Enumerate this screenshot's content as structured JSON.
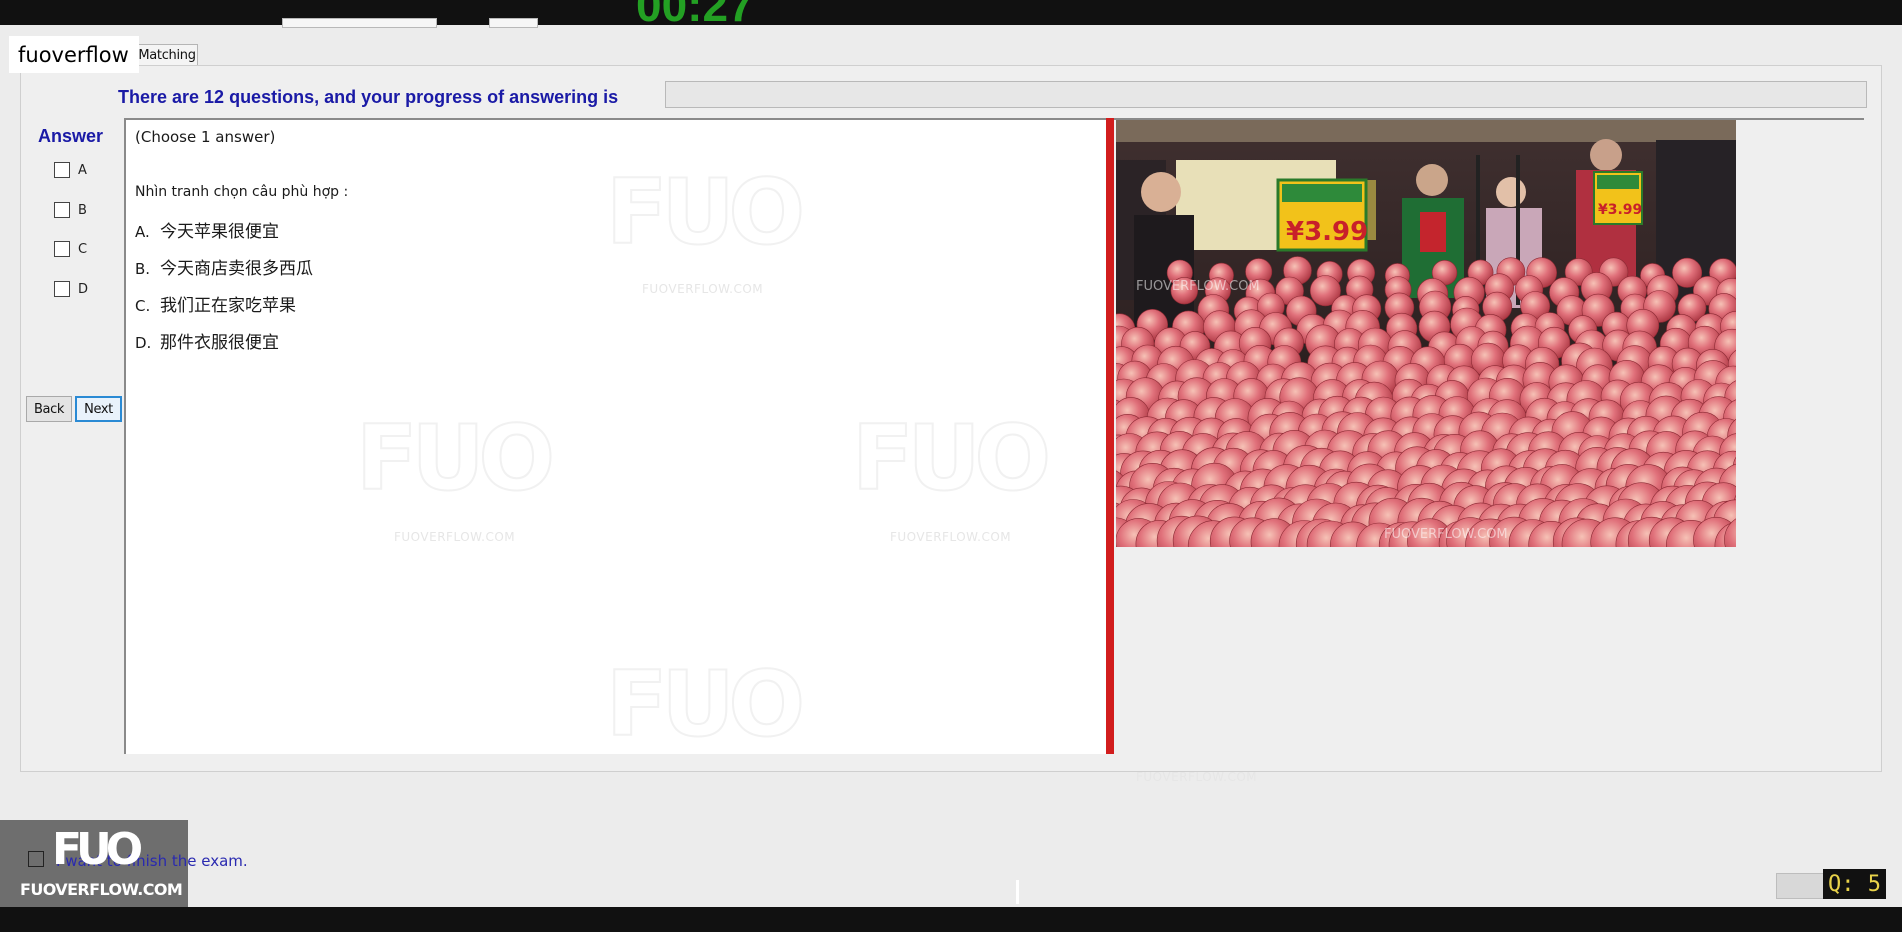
{
  "header": {
    "brand": "fuoverflow",
    "tab": "Matching"
  },
  "progress": {
    "label": "There are 12 questions, and your progress of answering is",
    "fraction": 0.0
  },
  "answer_panel": {
    "heading": "Answer",
    "options": [
      "A",
      "B",
      "C",
      "D"
    ],
    "back_label": "Back",
    "next_label": "Next"
  },
  "question": {
    "instruction": "(Choose 1 answer)",
    "prompt": "Nhìn tranh chọn câu phù hợp :",
    "choices": [
      {
        "letter": "A.",
        "text": "今天苹果很便宜"
      },
      {
        "letter": "B.",
        "text": "今天商店卖很多西瓜"
      },
      {
        "letter": "C.",
        "text": "我们正在家吃苹果"
      },
      {
        "letter": "D.",
        "text": "那件衣服很便宜"
      }
    ]
  },
  "image": {
    "description_icon": "apples-photo",
    "price_tags": [
      "¥3.99",
      "¥3.99"
    ],
    "watermark": "FUOVERFLOW.COM"
  },
  "watermark": {
    "logo": "FUO",
    "site": "FUOVERFLOW.COM"
  },
  "footer": {
    "finish_label": "I want to finish the exam.",
    "logo": "FUO",
    "logo_site": "FUOVERFLOW.COM",
    "question_counter": "Q: 5"
  },
  "colors": {
    "heading_blue": "#1a1aa6",
    "divider_red": "#d21d1d",
    "counter_text": "#e8d24a"
  }
}
